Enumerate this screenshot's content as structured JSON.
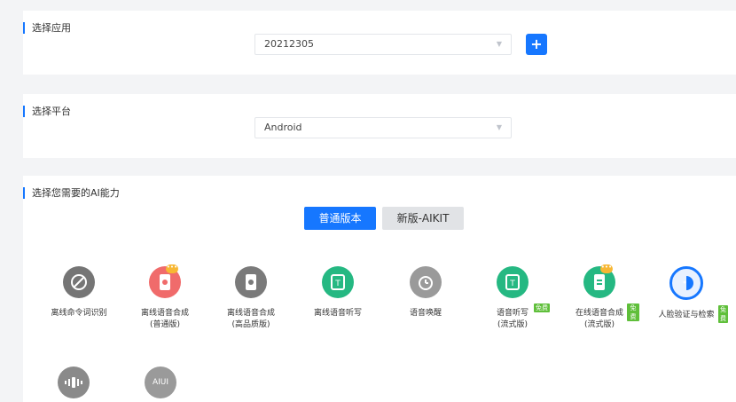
{
  "app_section": {
    "title": "选择应用",
    "selected_value": "20212305",
    "add_label": "+"
  },
  "platform_section": {
    "title": "选择平台",
    "selected_value": "Android"
  },
  "ability_section": {
    "title": "选择您需要的AI能力",
    "versions": [
      {
        "label": "普通版本",
        "active": true
      },
      {
        "label": "新版-AIKIT",
        "active": false
      }
    ],
    "items": [
      {
        "label": "离线命令词识别",
        "sub": "",
        "icon": "mic-slash-icon",
        "color": "#757575"
      },
      {
        "label": "离线语音合成",
        "sub": "(普通版)",
        "icon": "phone-speech-icon",
        "color": "#f06b6b"
      },
      {
        "label": "离线语音合成",
        "sub": "(高品质版)",
        "icon": "phone-speech-icon",
        "color": "#7a7a7a"
      },
      {
        "label": "离线语音听写",
        "sub": "",
        "icon": "transcribe-icon",
        "color": "#25b882"
      },
      {
        "label": "语音唤醒",
        "sub": "",
        "icon": "alarm-clock-icon",
        "color": "#9a9a9a"
      },
      {
        "label": "语音听写",
        "sub": "(流式版)",
        "icon": "transcribe-icon",
        "color": "#25b882",
        "badge": "免费"
      },
      {
        "label": "在线语音合成",
        "sub": "(流式版)",
        "icon": "phone-chat-icon",
        "color": "#25b882",
        "badge": "免费"
      },
      {
        "label": "人脸验证与检索",
        "sub": "",
        "icon": "face-scan-icon",
        "color": "#1677ff",
        "badge": "免费"
      },
      {
        "label": "",
        "sub": "",
        "icon": "audio-wave-icon",
        "color": "#8a8a8a"
      },
      {
        "label": "",
        "sub": "",
        "icon": "aiui-icon",
        "color": "#9a9a9a",
        "icon_text": "AIUI"
      }
    ]
  },
  "colors": {
    "accent": "#1677ff",
    "badge": "#5fbf3a",
    "background": "#f3f4f6"
  }
}
